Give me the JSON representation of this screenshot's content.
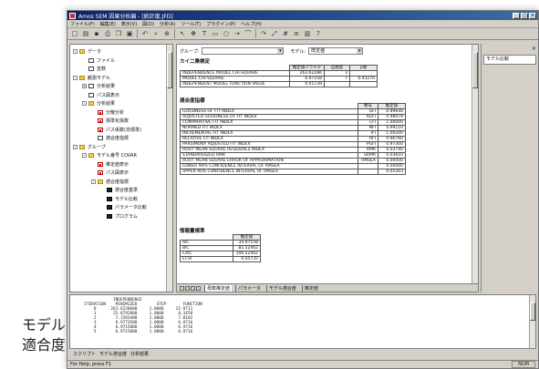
{
  "caption": {
    "line1": "モデル",
    "line2": "適合度"
  },
  "window": {
    "title": "Amos SEM 因果分析編 - [統計度.JFD]",
    "controls": [
      "_",
      "□",
      "×"
    ]
  },
  "menu": [
    "ファイル(F)",
    "編集(E)",
    "表示(V)",
    "図(D)",
    "分析(A)",
    "ツール(T)",
    "プラグイン(P)",
    "ヘルプ(H)"
  ],
  "toolbar_icons": [
    "new-icon",
    "open-icon",
    "save-icon",
    "print-icon",
    "copy-icon",
    "paste-icon",
    "undo-icon",
    "find-icon",
    "zoom-icon",
    "pointer-icon",
    "move-icon",
    "text-icon",
    "rect-icon",
    "oval-icon",
    "arrow-icon",
    "curve-icon",
    "redo-icon",
    "fit-icon",
    "grid-icon",
    "list-icon",
    "chart-icon",
    "help-icon"
  ],
  "tree": [
    {
      "level": 0,
      "icon": "folder",
      "expand": "-",
      "label": "データ"
    },
    {
      "level": 1,
      "icon": "doc",
      "expand": "",
      "label": "ファイル"
    },
    {
      "level": 1,
      "icon": "doc",
      "expand": "",
      "label": "変数"
    },
    {
      "level": 0,
      "icon": "folder",
      "expand": "-",
      "label": "観測モデル"
    },
    {
      "level": 1,
      "icon": "doc",
      "expand": "+",
      "label": "分析結果"
    },
    {
      "level": 1,
      "icon": "doc",
      "expand": "",
      "label": "パス図表示"
    },
    {
      "level": 1,
      "icon": "folder",
      "expand": "-",
      "label": "分析結果"
    },
    {
      "level": 2,
      "icon": "docr",
      "expand": "",
      "label": "分散分析"
    },
    {
      "level": 2,
      "icon": "docr",
      "expand": "",
      "label": "標準化係数"
    },
    {
      "level": 2,
      "icon": "docr",
      "expand": "",
      "label": "パス係数(非標準)"
    },
    {
      "level": 2,
      "icon": "doc",
      "expand": "",
      "label": "適合度指標"
    },
    {
      "level": 0,
      "icon": "folder",
      "expand": "-",
      "label": "グループ"
    },
    {
      "level": 1,
      "icon": "folder",
      "expand": "-",
      "label": "モデル番号 COVAR"
    },
    {
      "level": 2,
      "icon": "docr",
      "expand": "",
      "label": "推定値表示"
    },
    {
      "level": 2,
      "icon": "docr",
      "expand": "",
      "label": "パス図表示"
    },
    {
      "level": 2,
      "icon": "folder",
      "expand": "-",
      "label": "適合度指標"
    },
    {
      "level": 3,
      "icon": "docb",
      "expand": "",
      "label": "適合度基準"
    },
    {
      "level": 3,
      "icon": "docb",
      "expand": "",
      "label": "モデル比較"
    },
    {
      "level": 3,
      "icon": "docb",
      "expand": "",
      "label": "パラメータ比較"
    },
    {
      "level": 3,
      "icon": "docb",
      "expand": "",
      "label": "プログラム"
    }
  ],
  "main": {
    "group_label": "グループ:",
    "group_value": "",
    "model_label": "モデル:",
    "model_value": "既定値",
    "section1": "カイ二乗検定",
    "table1": {
      "headers": [
        "",
        "推定値パラメタ",
        "自由度",
        "p値"
      ],
      "rows": [
        [
          "INDEPENDENCE MODEL CHI-SQUARE",
          "263.62286",
          "3",
          ""
        ],
        [
          "MODEL CHI-SQUARE",
          "6.97158",
          "7",
          "0.43270"
        ],
        [
          "INDEPENDENT MODEL FUNCTION VALUE",
          "0.01739",
          "",
          ""
        ]
      ]
    },
    "section2": "適合度指標",
    "table2": {
      "headers": [
        "",
        "略号",
        "推定値"
      ],
      "rows": [
        [
          "GOODNESS OF FIT INDEX",
          "GFI",
          "0.99640"
        ],
        [
          "ADJUSTED GOODNESS OF FIT INDEX",
          "AGFI",
          "0.98979"
        ],
        [
          "COMPARATIVE FIT INDEX",
          "CFI",
          "1.00000"
        ],
        [
          "NORMED FIT INDEX",
          "NFI",
          "0.99110"
        ],
        [
          "INCREMENTAL FIT INDEX",
          "IFI",
          "1.00200"
        ],
        [
          "RELATIVE FIT INDEX",
          "RFI",
          "0.96760"
        ],
        [
          "PARSIMONY ADJUSTED FIT INDEX",
          "PGFI",
          "0.97300"
        ],
        [
          "ROOT MEAN SQUARE RESIDUALS INDEX",
          "RMR",
          "0.03740"
        ],
        [
          "STANDARDIZED RMR",
          "SRMR",
          "0.03610"
        ],
        [
          "ROOT MEAN SQUARE ERROR OF APPROXIMATION",
          "RMSEA",
          "0.00000"
        ],
        [
          "LOWER 90% CONFIDENCE INTERVAL OF RMSEA",
          "",
          "0.00000"
        ],
        [
          "UPPER 90% CONFIDENCE INTERVAL OF RMSEA",
          "",
          "0.05303"
        ]
      ]
    },
    "section3": "情報量規準",
    "table3": {
      "headers": [
        "",
        "推定値"
      ],
      "rows": [
        [
          "AIC",
          "34.97158"
        ],
        [
          "BIC",
          "81.52462"
        ],
        [
          "CAIC",
          "106.52462"
        ],
        [
          "ECVI",
          "0.05735"
        ]
      ]
    },
    "tabs": [
      "母数推定値",
      "パラメータ",
      "モデル適合度",
      "推定値"
    ]
  },
  "right_pane": {
    "title": "×",
    "item": "モデル比較"
  },
  "output": {
    "text": "              INDEPENDENCE\n  ITERATION    MINIMIZED        STEP       FUNCTION\n      0      263.6228600     1.0000     22.9711\n      1       25.8792800     1.0000      8.3458\n      2        7.1583400     1.0000      7.0102\n      3        6.9773500     1.0000      6.9716\n      4        6.9715800     1.0000      6.9716\n      5        6.9715800     1.0000      6.9716",
    "tabs": [
      "スクリプト",
      "モデル適合度",
      "分析結果"
    ]
  },
  "status": {
    "left": "For Help, press F1",
    "right": "NUM"
  }
}
